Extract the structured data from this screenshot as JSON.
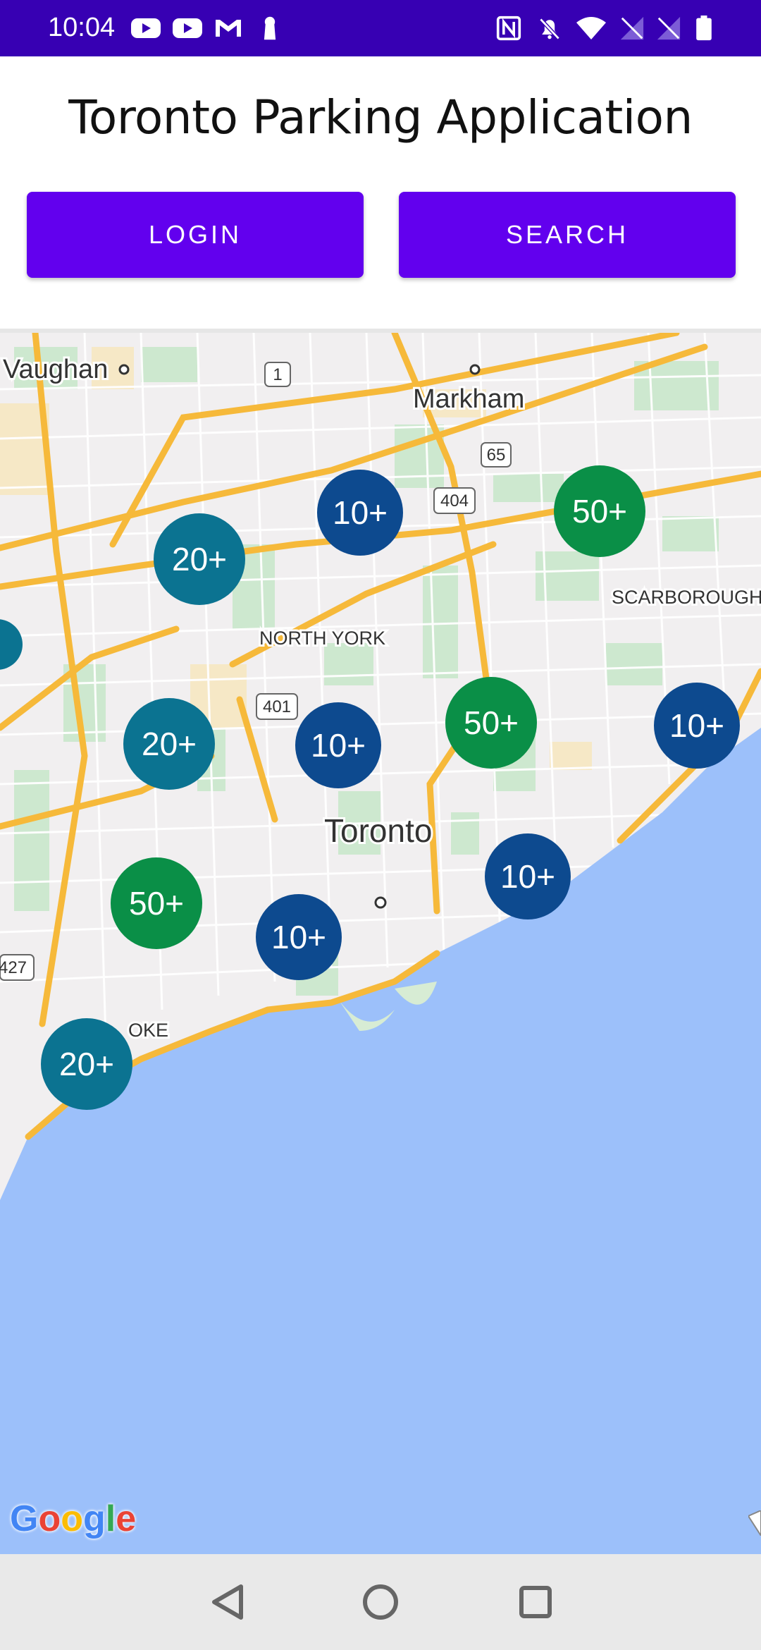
{
  "status_bar": {
    "time": "10:04",
    "left_icons": [
      "youtube-icon",
      "youtube-icon",
      "gmail-icon",
      "keyhole-icon"
    ],
    "right_icons": [
      "nfc-icon",
      "bell-off-icon",
      "wifi-icon",
      "signal-icon",
      "signal-icon",
      "battery-icon"
    ],
    "background": "#3700B3"
  },
  "header": {
    "title": "Toronto Parking Application"
  },
  "buttons": {
    "login_label": "LOGIN",
    "search_label": "SEARCH",
    "color": "#6200EE"
  },
  "map": {
    "place_labels": {
      "vaughan": "Vaughan",
      "markham": "Markham",
      "north_york": "NORTH YORK",
      "scarborough": "SCARBOROUGH",
      "toronto": "Toronto",
      "etobicoke": "OKE"
    },
    "highway_shields": {
      "h1": "1",
      "h65": "65",
      "h404": "404",
      "h401": "401",
      "h427": "427"
    },
    "clusters": [
      {
        "label": "10+",
        "color": "#0D4A8F"
      },
      {
        "label": "50+",
        "color": "#0A8F47"
      },
      {
        "label": "20+",
        "color": "#0B7391"
      },
      {
        "label": "20+",
        "color": "#0B7391"
      },
      {
        "label": "10+",
        "color": "#0D4A8F"
      },
      {
        "label": "50+",
        "color": "#0A8F47"
      },
      {
        "label": "10+",
        "color": "#0D4A8F"
      },
      {
        "label": "10+",
        "color": "#0D4A8F"
      },
      {
        "label": "50+",
        "color": "#0A8F47"
      },
      {
        "label": "10+",
        "color": "#0D4A8F"
      },
      {
        "label": "20+",
        "color": "#0B7391"
      }
    ],
    "water_color": "#9CC0FA",
    "land_color": "#F1EFF0",
    "attribution": "Google"
  },
  "nav_bar": {
    "icons": [
      "back-icon",
      "home-icon",
      "recents-icon"
    ]
  }
}
